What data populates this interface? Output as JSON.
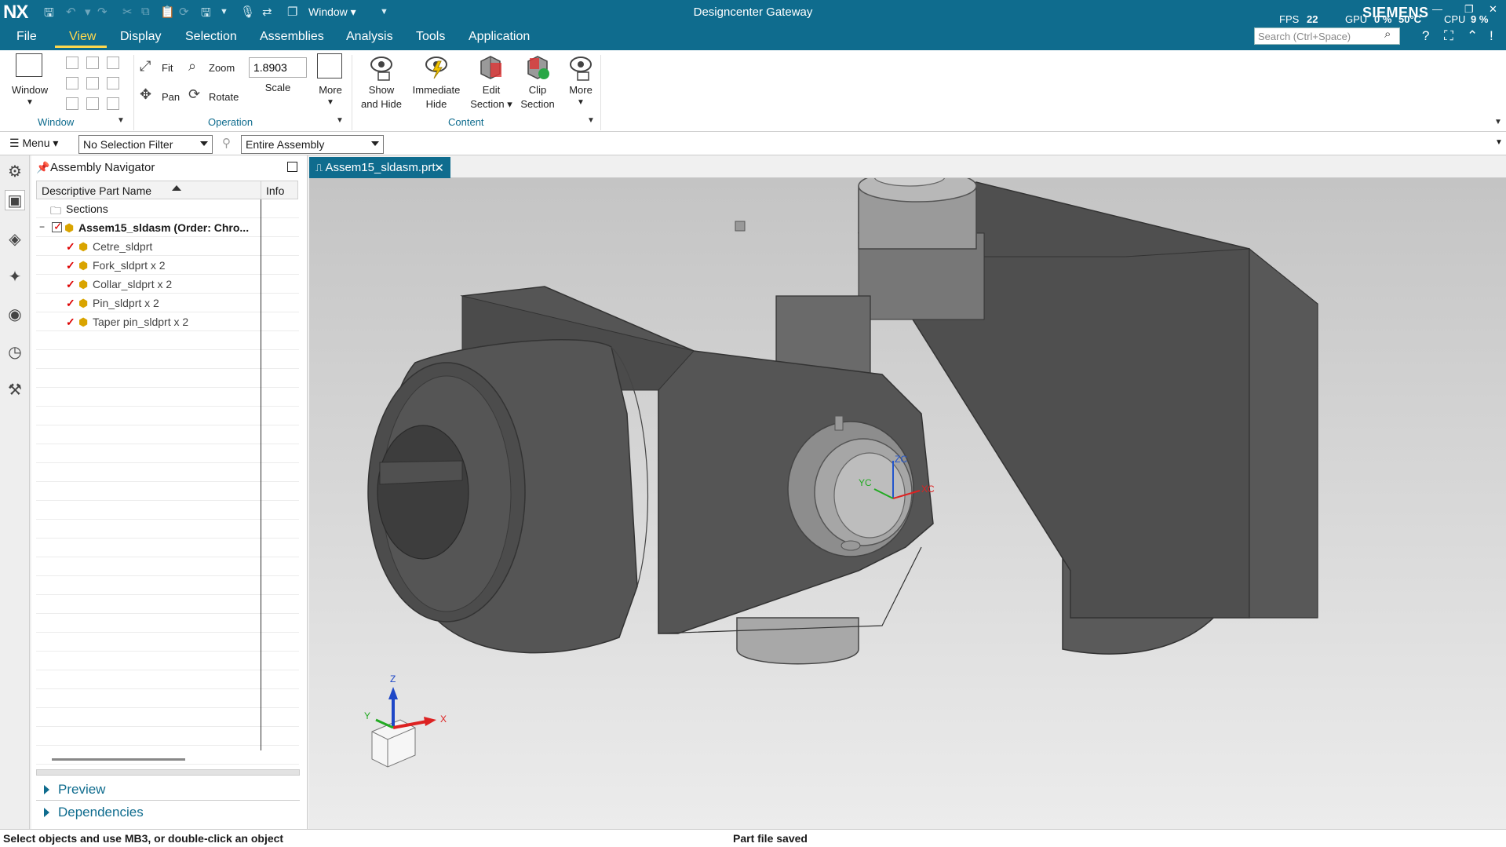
{
  "app": {
    "logo": "NX",
    "title": "Designcenter Gateway",
    "window_menu": "Window",
    "brand": "SIEMENS"
  },
  "perf": {
    "fps_label": "FPS",
    "fps_value": "22",
    "gpu_label": "GPU",
    "gpu_value": "0 %",
    "gpu_temp": "50°C",
    "cpu_label": "CPU",
    "cpu_value": "9 %"
  },
  "menu": {
    "items": [
      "File",
      "View",
      "Display",
      "Selection",
      "Assemblies",
      "Analysis",
      "Tools",
      "Application"
    ],
    "active": "View",
    "search_placeholder": "Search (Ctrl+Space)"
  },
  "ribbon": {
    "window_label": "Window",
    "fit": "Fit",
    "zoom": "Zoom",
    "pan": "Pan",
    "rotate": "Rotate",
    "scale_value": "1.8903",
    "scale_label": "Scale",
    "more1": "More",
    "show_hide_1": "Show",
    "show_hide_2": "and Hide",
    "immediate_1": "Immediate",
    "immediate_2": "Hide",
    "edit_1": "Edit",
    "edit_2": "Section",
    "clip_1": "Clip",
    "clip_2": "Section",
    "more2": "More",
    "group_window": "Window",
    "group_operation": "Operation",
    "group_content": "Content"
  },
  "selection_bar": {
    "menu": "Menu",
    "filter": "No Selection Filter",
    "scope": "Entire Assembly"
  },
  "navigator": {
    "title": "Assembly Navigator",
    "col_name": "Descriptive Part Name",
    "col_info": "Info",
    "rows": [
      {
        "label": "Sections"
      },
      {
        "label": "Assem15_sldasm (Order: Chro..."
      },
      {
        "label": "Cetre_sldprt"
      },
      {
        "label": "Fork_sldprt x 2"
      },
      {
        "label": "Collar_sldprt x 2"
      },
      {
        "label": "Pin_sldprt x 2"
      },
      {
        "label": "Taper pin_sldprt x 2"
      }
    ],
    "preview": "Preview",
    "dependencies": "Dependencies"
  },
  "graphics": {
    "tab": "Assem15_sldasm.prt",
    "triad": {
      "x": "X",
      "y": "Y",
      "z": "Z"
    },
    "wcs": {
      "xc": "XC",
      "yc": "YC",
      "zc": "ZC"
    }
  },
  "status": {
    "left": "Select objects and use MB3, or double-click an object",
    "center": "Part file saved"
  },
  "colors": {
    "accent": "#0f6c8e",
    "active_menu": "#ffd84d",
    "model": "#505050"
  }
}
